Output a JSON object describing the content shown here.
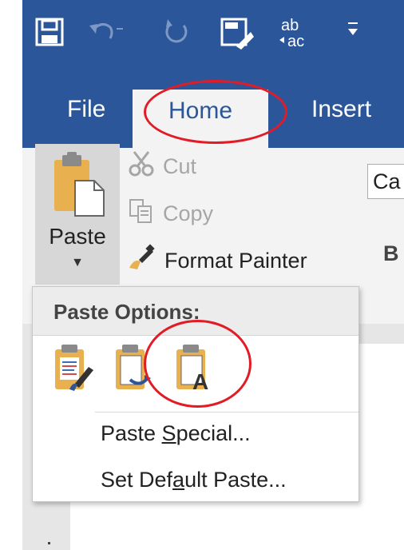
{
  "quick_access": {
    "icons": [
      "save-icon",
      "undo-icon",
      "redo-icon",
      "touch-mode-icon",
      "spelling-icon",
      "customize-qat-icon"
    ]
  },
  "tabs": [
    {
      "label": "File",
      "active": false
    },
    {
      "label": "Home",
      "active": true
    },
    {
      "label": "Insert",
      "active": false
    }
  ],
  "clipboard": {
    "paste_label": "Paste",
    "cut_label": "Cut",
    "copy_label": "Copy",
    "format_painter_label": "Format Painter"
  },
  "font": {
    "name_fragment": "Ca",
    "bold_label": "B"
  },
  "paste_menu": {
    "header": "Paste Options:",
    "options": [
      {
        "name": "keep-source-formatting-icon"
      },
      {
        "name": "merge-formatting-icon"
      },
      {
        "name": "keep-text-only-icon"
      }
    ],
    "paste_special": {
      "before": "Paste ",
      "access_key": "S",
      "after": "pecial..."
    },
    "set_default": {
      "before": "Set Def",
      "access_key": "a",
      "after": "ult Paste..."
    }
  },
  "colors": {
    "title_bar": "#2b579a",
    "ribbon": "#f3f3f3",
    "highlight": "#e21b26",
    "clipboard_gold": "#e8b04e"
  }
}
